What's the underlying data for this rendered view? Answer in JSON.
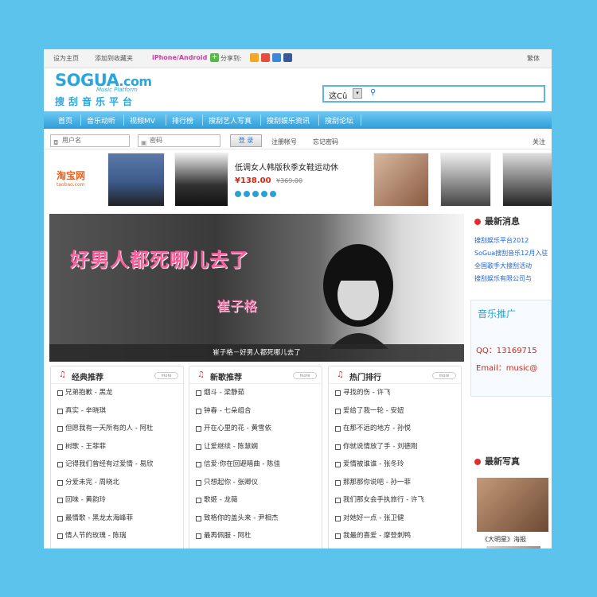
{
  "topbar": {
    "set_home": "设为主页",
    "add_fav": "添加到收藏夹",
    "mobile": "iPhone/Android",
    "share": "分享到:",
    "traditional": "繁体"
  },
  "header": {
    "logo_text": "SOGUA",
    "logo_tld": ".com",
    "logo_sub": "Music Platform",
    "logo_cn": "搜刮音乐平台",
    "search_query": "这Cû"
  },
  "nav": {
    "items": [
      "首页",
      "音乐动听",
      "视频MV",
      "排行榜",
      "搜刮艺人写真",
      "搜刮娱乐资讯",
      "搜刮论坛"
    ]
  },
  "login": {
    "username_placeholder": "用户名",
    "password_placeholder": "密码",
    "login_button": "登 录",
    "register": "注册帐号",
    "forgot": "忘记密码",
    "follow": "关注"
  },
  "ad": {
    "taobao": "淘宝网",
    "taobao_sub": "taobao.com",
    "title": "低调女人韩版秋季女鞋运动休",
    "price": "¥138.00",
    "old_price": "¥369.00"
  },
  "banner": {
    "title": "好男人都死哪儿去了",
    "artist": "崔子格",
    "caption": "崔子格－好男人都死哪儿去了"
  },
  "sidebar": {
    "news_title": "最新消息",
    "news": [
      "搜刮娱乐平台2012",
      "SoGua搜刮音乐12月入驻",
      "全国歌手大搜刮活动",
      "搜刮娱乐有限公司与"
    ],
    "promo_title": "音乐推广",
    "promo_qq": "QQ：13169715",
    "promo_email": "Email：music@",
    "photos_title": "最新写真",
    "photo_caption": "《大明星》海报"
  },
  "columns": [
    {
      "title": "经典推荐",
      "more": "more",
      "songs": [
        "兄弟抱歉 - 黑龙",
        "真实 - 辛晓琪",
        "但愿我有一天所有的人 - 阿杜",
        "树歌 - 王菲菲",
        "记得我们曾经有过爱情 - 易欣",
        "分爱未完 - 周晓北",
        "回味 - 黄韵玲",
        "最情歌 - 黑龙太海峰菲",
        "情人节的玫瑰 - 陈瑞"
      ]
    },
    {
      "title": "新歌推荐",
      "more": "more",
      "songs": [
        "烟斗 - 梁静茹",
        "钟春 - 七朵组合",
        "开在心里的花 - 黄雪依",
        "让爱继续 - 陈慧娴",
        "信爱·你在回避暗曲 - 陈佳",
        "只想起你 - 张卿仪",
        "歌姬 - 龙薇",
        "致格你的盖头来 - 尹相杰",
        "最再佩服 - 阿杜"
      ]
    },
    {
      "title": "热门排行",
      "more": "more",
      "songs": [
        "寻找的伤 - 许飞",
        "爱给了我一轮 - 安妞",
        "在那不远的地方 - 孙悦",
        "你就说情放了手 - 刘德刚",
        "爱情被谁谁 - 张冬玲",
        "那那那你说吧 - 孙一菲",
        "我们那女会手执旅行 - 许飞",
        "对她好一点 - 张卫健",
        "我最的喜爱 - 摩登刺鸭"
      ]
    }
  ]
}
